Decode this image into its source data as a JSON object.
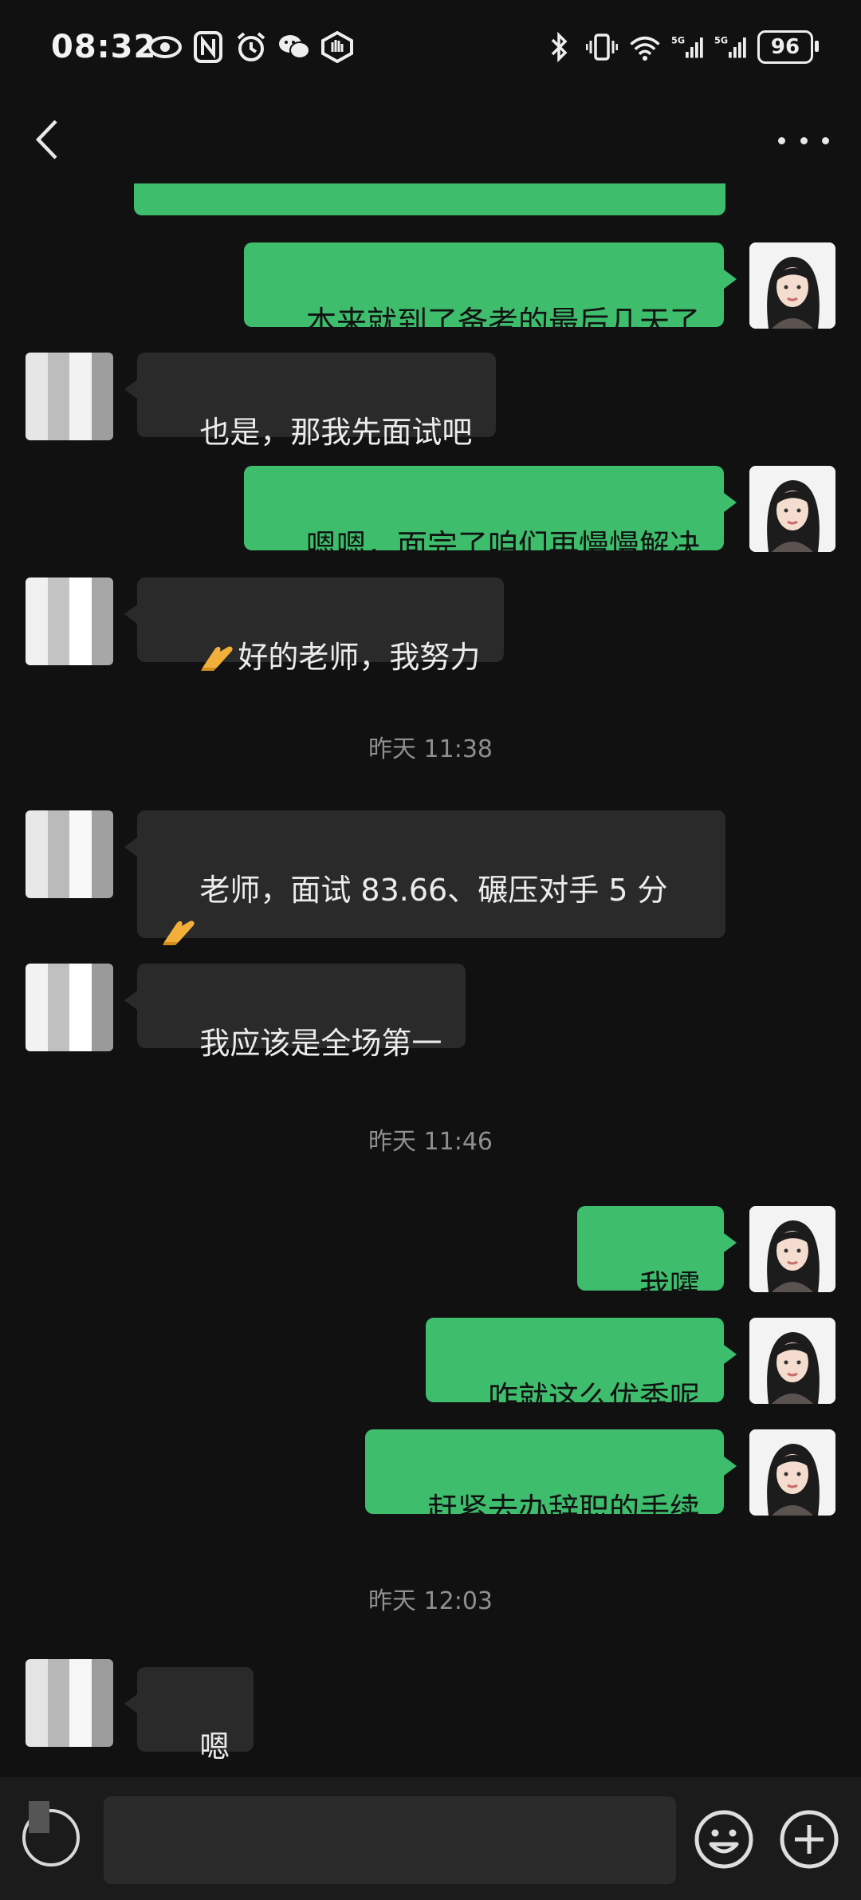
{
  "status_bar": {
    "time": "08:32",
    "battery": "96",
    "left_icons": [
      "eye-icon",
      "nfc-icon",
      "alarm-icon",
      "wechat-icon",
      "hand-icon"
    ],
    "right_icons": [
      "bluetooth-icon",
      "vibrate-icon",
      "wifi-icon",
      "signal-5g-icon",
      "signal-5g-icon"
    ]
  },
  "header": {
    "title": "",
    "back_icon": "chevron-left-icon",
    "more_icon": "more-dots-icon"
  },
  "messages": [
    {
      "side": "out",
      "text": ""
    },
    {
      "side": "out",
      "text": "本来就到了备考的最后几天了"
    },
    {
      "side": "in",
      "text": "也是，那我先面试吧"
    },
    {
      "side": "out",
      "text": "嗯嗯，面完了咱们再慢慢解决"
    },
    {
      "side": "in",
      "text": "好的老师，我努力",
      "emoji": "raised-hands-icon"
    },
    {
      "side": "in",
      "text": "老师，面试 83.66、碾压对手 5 分",
      "emoji": "raised-hands-icon"
    },
    {
      "side": "in",
      "text": "我应该是全场第一"
    },
    {
      "side": "out",
      "text": "我嚯"
    },
    {
      "side": "out",
      "text": "咋就这么优秀呢"
    },
    {
      "side": "out",
      "text": "赶紧去办辞职的手续"
    },
    {
      "side": "in",
      "text": "嗯"
    }
  ],
  "timestamps": [
    "昨天 11:38",
    "昨天 11:46",
    "昨天 12:03"
  ],
  "input_bar": {
    "voice_icon": "voice-icon",
    "emoji_icon": "smiley-icon",
    "plus_icon": "plus-circle-icon"
  },
  "colors": {
    "background": "#111111",
    "outgoing_bubble": "#3ebd6d",
    "incoming_bubble": "#2a2a2a",
    "timestamp": "#8f8f8f"
  }
}
